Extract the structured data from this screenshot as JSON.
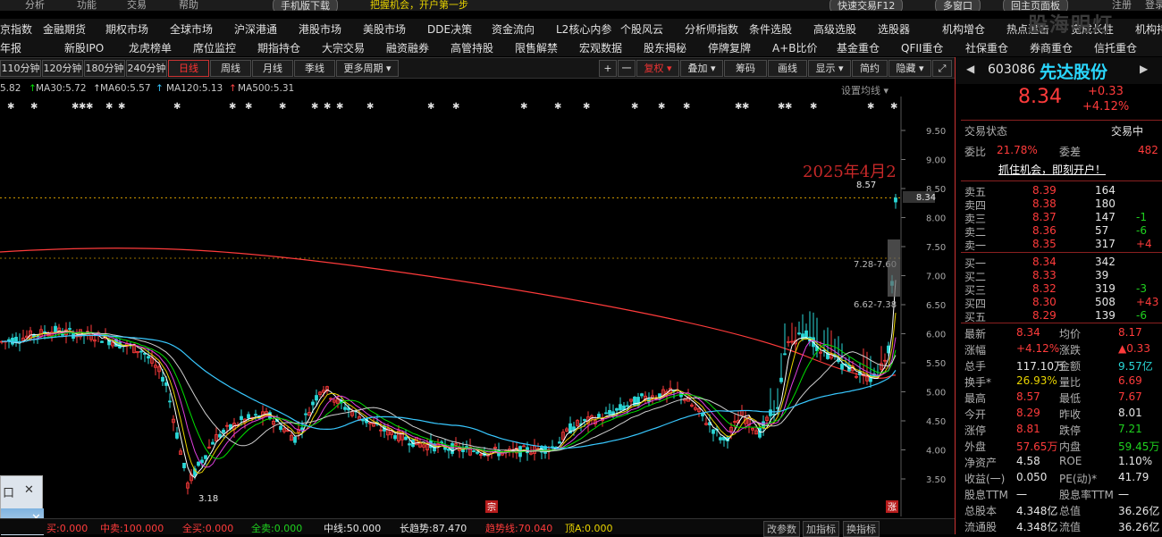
{
  "topbar": {
    "items": [
      "分析",
      "功能",
      "交易",
      "帮助"
    ],
    "mobile_download": "手机版下载",
    "promo": "把握机会，开户第一步",
    "quick_trade": "快速交易F12",
    "multi_screen": "多窗口",
    "return_main": "回主页面板",
    "register": "注册",
    "login": "登录",
    "watermark": "股海明灯"
  },
  "menu_row1": [
    "京指数",
    "金融期货",
    "期权市场",
    "全球市场",
    "沪深港通",
    "港股市场",
    "美股市场",
    "DDE决策",
    "资金流向",
    "L2核心内参",
    "个股风云",
    "分析师指数",
    "条件选股",
    "高级选股",
    "选股器",
    "机构增仓",
    "热点追击",
    "宽成长性",
    "机构持"
  ],
  "menu_row2": [
    "年报",
    "新股IPO",
    "龙虎榜单",
    "席位监控",
    "期指持仓",
    "大宗交易",
    "融资融券",
    "高管持股",
    "限售解禁",
    "宏观数据",
    "股东揭秘",
    "停牌复牌",
    "A+B比价",
    "基金重仓",
    "QFII重仓",
    "社保重仓",
    "券商重仓",
    "信托重仓"
  ],
  "toolbar": {
    "periods": [
      "110分钟",
      "120分钟",
      "180分钟",
      "240分钟",
      "日线",
      "周线",
      "月线",
      "季线",
      "更多周期"
    ],
    "active_period": "日线",
    "plus": "+",
    "minus": "一",
    "fuquan": "复权",
    "overlay": "叠加",
    "chips": "筹码",
    "draw": "画线",
    "display": "显示",
    "simple": "简约",
    "hide": "隐藏"
  },
  "ma_legend": [
    {
      "text": "5.82",
      "color": "#e040e0"
    },
    {
      "text": "MA30:5.72",
      "color": "#00e000"
    },
    {
      "text": "MA60:5.57",
      "color": "#d0d0d0"
    },
    {
      "text": "MA120:5.13",
      "color": "#38c8ff"
    },
    {
      "text": "MA500:5.31",
      "color": "#ff4444"
    }
  ],
  "set_ma": "设置均线",
  "chart_data": {
    "type": "candlestick",
    "y_ticks": [
      "9.50",
      "9.00",
      "8.50",
      "8.00",
      "7.50",
      "7.00",
      "6.50",
      "6.00",
      "5.50",
      "5.00",
      "4.50",
      "4.00",
      "3.50"
    ],
    "current_price": "8.34",
    "high_label": "8.57",
    "low_label": "3.18",
    "date_annotation": "2025年4月2",
    "range_label_1": "7.28-7.60",
    "range_label_2": "6.62-7.38",
    "markers": [
      "宗",
      "涨"
    ]
  },
  "bottom": {
    "items": [
      {
        "text": "买:0.000",
        "color": "#ff3b3b"
      },
      {
        "text": "中卖:100.000",
        "color": "#ff3b3b"
      },
      {
        "text": "全买:0.000",
        "color": "#ff3b3b"
      },
      {
        "text": "全卖:0.000",
        "color": "#1fd21f"
      },
      {
        "text": "中线:50.000",
        "color": "#e6e6e6"
      },
      {
        "text": "长趋势:87.470",
        "color": "#e6e6e6"
      },
      {
        "text": "趋势线:70.040",
        "color": "#ff3b3b"
      },
      {
        "text": "顶A:0.000",
        "color": "#e8d300"
      }
    ],
    "tabs": [
      "改参数",
      "加指标",
      "换指标"
    ]
  },
  "popup": {
    "label": "口",
    "close": "✕"
  },
  "sidebar": {
    "code": "603086",
    "name": "先达股份",
    "price": "8.34",
    "change": "+0.33",
    "change_pct": "+4.12%",
    "trade_status_label": "交易状态",
    "trade_status": "交易中",
    "weibi_label": "委比",
    "weibi": "21.78%",
    "weicha_label": "委差",
    "weicha": "482",
    "promo": "抓住机会，即刻开户！",
    "asks": [
      {
        "label": "卖五",
        "price": "8.39",
        "vol": "164",
        "chg": ""
      },
      {
        "label": "卖四",
        "price": "8.38",
        "vol": "180",
        "chg": ""
      },
      {
        "label": "卖三",
        "price": "8.37",
        "vol": "147",
        "chg": "-1"
      },
      {
        "label": "卖二",
        "price": "8.36",
        "vol": "57",
        "chg": "-6"
      },
      {
        "label": "卖一",
        "price": "8.35",
        "vol": "317",
        "chg": "+4"
      }
    ],
    "bids": [
      {
        "label": "买一",
        "price": "8.34",
        "vol": "342",
        "chg": ""
      },
      {
        "label": "买二",
        "price": "8.33",
        "vol": "39",
        "chg": ""
      },
      {
        "label": "买三",
        "price": "8.32",
        "vol": "319",
        "chg": "-3"
      },
      {
        "label": "买四",
        "price": "8.30",
        "vol": "508",
        "chg": "+43"
      },
      {
        "label": "买五",
        "price": "8.29",
        "vol": "139",
        "chg": "-6"
      }
    ],
    "stats": [
      {
        "l1": "最新",
        "v1": "8.34",
        "c1": "red",
        "l2": "均价",
        "v2": "8.17",
        "c2": "red"
      },
      {
        "l1": "涨幅",
        "v1": "+4.12%",
        "c1": "red",
        "l2": "涨跌",
        "v2": "▲0.33",
        "c2": "red"
      },
      {
        "l1": "总手",
        "v1": "117.10万",
        "c1": "white",
        "l2": "金额",
        "v2": "9.57亿",
        "c2": "cyan"
      },
      {
        "l1": "换手*",
        "v1": "26.93%",
        "c1": "yellow",
        "l2": "量比",
        "v2": "6.69",
        "c2": "red"
      },
      {
        "l1": "最高",
        "v1": "8.57",
        "c1": "red",
        "l2": "最低",
        "v2": "7.67",
        "c2": "red"
      },
      {
        "l1": "今开",
        "v1": "8.29",
        "c1": "red",
        "l2": "昨收",
        "v2": "8.01",
        "c2": "white"
      },
      {
        "l1": "涨停",
        "v1": "8.81",
        "c1": "red",
        "l2": "跌停",
        "v2": "7.21",
        "c2": "green"
      },
      {
        "l1": "外盘",
        "v1": "57.65万",
        "c1": "red",
        "l2": "内盘",
        "v2": "59.45万",
        "c2": "green"
      },
      {
        "l1": "净资产",
        "v1": "4.58",
        "c1": "white",
        "l2": "ROE",
        "v2": "1.10%",
        "c2": "white"
      },
      {
        "l1": "收益(一)",
        "v1": "0.050",
        "c1": "white",
        "l2": "PE(动)*",
        "v2": "41.79",
        "c2": "white"
      },
      {
        "l1": "股息TTM",
        "v1": "一",
        "c1": "white",
        "l2": "股息率TTM",
        "v2": "一",
        "c2": "white"
      },
      {
        "l1": "总股本",
        "v1": "4.348亿",
        "c1": "white",
        "l2": "总值",
        "v2": "36.26亿",
        "c2": "white"
      },
      {
        "l1": "流通股",
        "v1": "4.348亿",
        "c1": "white",
        "l2": "流值",
        "v2": "36.26亿",
        "c2": "white"
      }
    ]
  }
}
